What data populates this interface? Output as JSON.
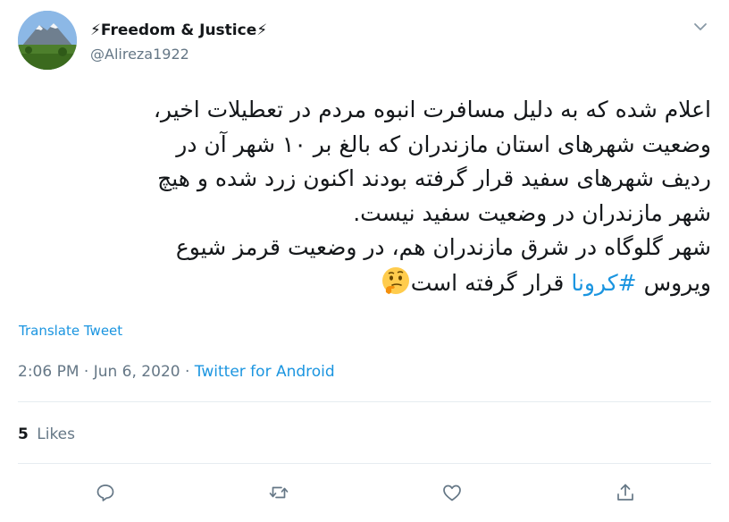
{
  "author": {
    "display_name": "⚡Freedom & Justice⚡",
    "handle": "@Alireza1922",
    "avatar_icon": "mountain-landscape-avatar"
  },
  "tweet": {
    "lines": [
      "اعلام شده که به دلیل مسافرت انبوه مردم در تعطیلات اخیر،",
      "وضعیت شهرهای استان مازندران که بالغ بر ۱۰ شهر آن در",
      "ردیف شهرهای سفید قرار گرفته بودند اکنون زرد شده و هیچ",
      "شهر مازندران در وضعیت سفید نیست.",
      "شهر گلوگاه در شرق مازندران هم، در وضعیت قرمز شیوع"
    ],
    "last_line_prefix": "ویروس ",
    "hashtag": "#کرونا",
    "last_line_suffix": " قرار گرفته است",
    "emoji": "thinking-face-icon"
  },
  "translate_label": "Translate Tweet",
  "meta": {
    "time": "2:06 PM",
    "separator1": " · ",
    "date": "Jun 6, 2020",
    "separator2": " · ",
    "source": "Twitter for Android"
  },
  "likes": {
    "count": "5",
    "label": "Likes"
  },
  "actions": [
    "reply-icon",
    "retweet-icon",
    "like-icon",
    "share-icon"
  ],
  "colors": {
    "link": "#1b95e0",
    "muted": "#657786",
    "text": "#14171a",
    "divider": "#e6ecf0"
  }
}
